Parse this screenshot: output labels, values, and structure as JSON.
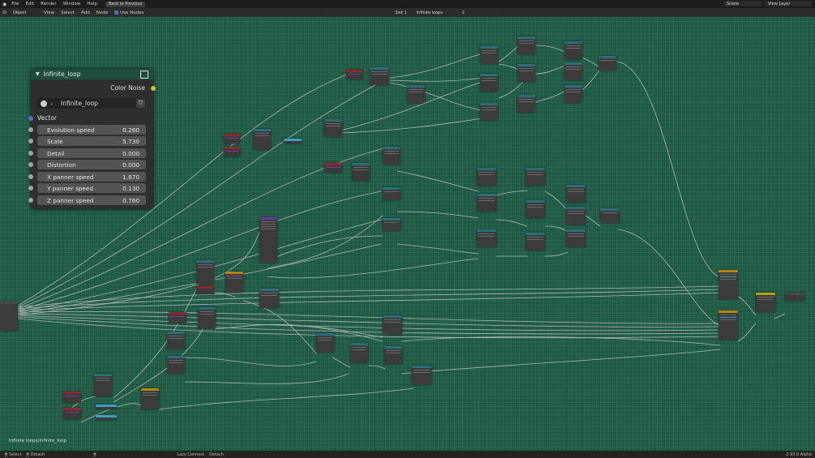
{
  "app": {
    "menu": [
      "File",
      "Edit",
      "Render",
      "Window",
      "Help"
    ],
    "back_label": "Back to Previous",
    "scene": "Scene",
    "view_layer": "View Layer"
  },
  "header": {
    "mode": "Object",
    "menu": [
      "View",
      "Select",
      "Add",
      "Node"
    ],
    "use_nodes": "Use Nodes",
    "slot": "Slot 1",
    "material": "Infinite loops",
    "users": "2"
  },
  "group_node": {
    "title": "Infinite_loop",
    "output_label": "Color Noise",
    "datablock": "Infinite_loop",
    "input_vector": "Vector",
    "params": [
      {
        "label": "Evolution speed",
        "value": "0.260"
      },
      {
        "label": "Scale",
        "value": "5.730"
      },
      {
        "label": "Detail",
        "value": "0.000"
      },
      {
        "label": "Distortion",
        "value": "0.000"
      },
      {
        "label": "X panner speed",
        "value": "1.870"
      },
      {
        "label": "Y panner speed",
        "value": "0.130"
      },
      {
        "label": "Z panner speed",
        "value": "0.760"
      }
    ],
    "colors": {
      "socket_out": "#d6c21e",
      "socket_vec": "#6464c7",
      "socket_val": "#a1a1a1"
    }
  },
  "breadcrumb": "Infinite loops/Infinite_loop",
  "status": {
    "select": "Select",
    "detach_left": "Detach",
    "lazy_connect": "Lazy Connect",
    "detach": "Detach",
    "version": "2.93.0 Alpha"
  },
  "colors": {
    "canvas": "#1f5a45",
    "node_body": "#3b3b3b",
    "header_teal": "#2a6e7a",
    "header_red": "#8a2a2a",
    "header_purple": "#6a2a8a",
    "header_orange": "#b8860b",
    "wire": "#c8c8c8"
  }
}
